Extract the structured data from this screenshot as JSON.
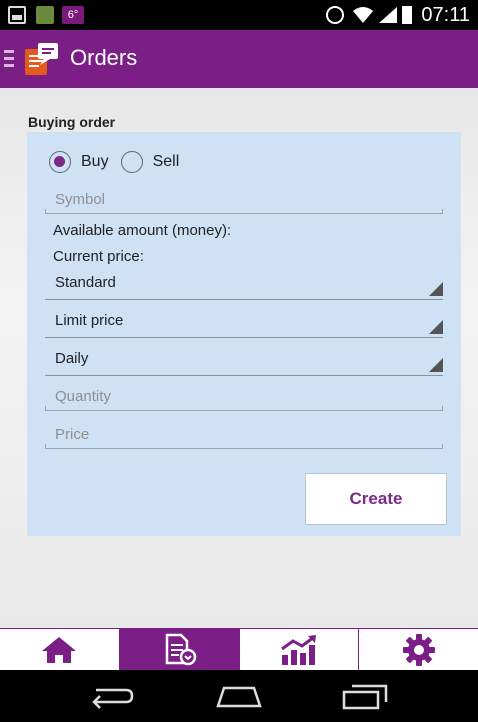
{
  "status_bar": {
    "notification_badge": "6°",
    "time": "07:11",
    "icons": [
      "image-notification-icon",
      "photo-notification-icon",
      "temperature-notification-icon",
      "alarm-icon",
      "wifi-icon",
      "signal-icon",
      "battery-icon"
    ]
  },
  "action_bar": {
    "title": "Orders",
    "icon": "orders-app-icon"
  },
  "form": {
    "section_title": "Buying order",
    "order_type": {
      "options": [
        "Buy",
        "Sell"
      ],
      "selected": "Buy"
    },
    "symbol_placeholder": "Symbol",
    "available_amount_label": "Available amount (money):",
    "current_price_label": "Current price:",
    "order_mode": "Standard",
    "price_type": "Limit price",
    "validity": "Daily",
    "quantity_placeholder": "Quantity",
    "price_placeholder": "Price",
    "create_label": "Create"
  },
  "tabs": [
    {
      "name": "home",
      "icon": "home-icon"
    },
    {
      "name": "orders",
      "icon": "orders-icon",
      "active": true
    },
    {
      "name": "charts",
      "icon": "chart-icon"
    },
    {
      "name": "settings",
      "icon": "gear-icon"
    }
  ],
  "colors": {
    "primary": "#7b1f86",
    "panel": "#cfe1f4",
    "accent_text": "#7b2a87"
  }
}
